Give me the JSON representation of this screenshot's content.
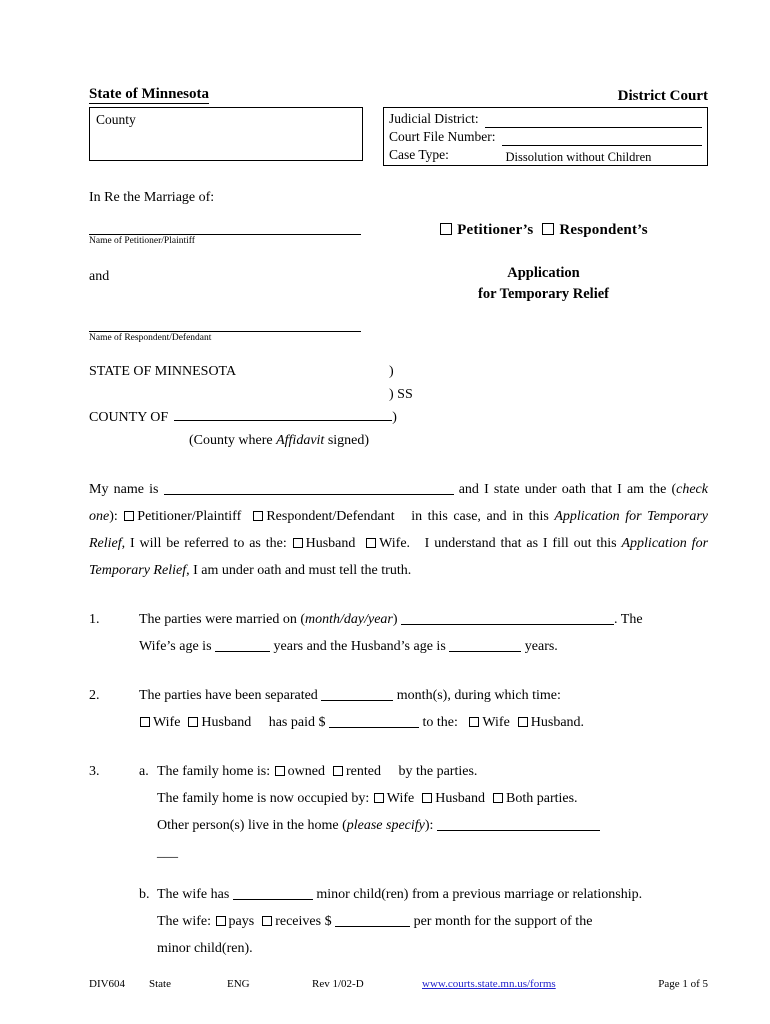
{
  "header": {
    "state_title": "State of Minnesota",
    "court_title": "District Court",
    "county_label": "County",
    "judicial_district_label": "Judicial District:",
    "judicial_district_value": "",
    "court_file_number_label": "Court File Number:",
    "court_file_number_value": "",
    "case_type_label": "Case Type:",
    "case_type_value": "Dissolution without Children"
  },
  "caption": {
    "in_re": "In Re the Marriage of:",
    "petitioner_caption": "Name of Petitioner/Plaintiff",
    "and": "and",
    "respondent_caption": "Name of Respondent/Defendant",
    "petitioners_label": "Petitioner’s",
    "respondents_label": "Respondent’s",
    "doc_title_line1": "Application",
    "doc_title_line2": "for Temporary Relief"
  },
  "venue": {
    "state_line": "STATE OF MINNESOTA",
    "paren_open": ")",
    "ss": ") SS",
    "county_of": "COUNTY OF",
    "paren_close": ")",
    "county_note_pre": "(County where ",
    "county_note_italic": "Affidavit",
    "county_note_post": " signed)"
  },
  "oath": {
    "p1_a": "My name is ",
    "p1_b": " and I state under oath that I am the (",
    "p1_check_one": "check  one",
    "p1_c": "): ",
    "p1_petitioner": "Petitioner/Plaintiff",
    "p1_respondent": "Respondent/Defendant",
    "p1_d": "in this case, and in this ",
    "p1_app_italic": "Application  for  Temporary  Relief",
    "p1_e": ", I will  be  referred  to  as  the: ",
    "p1_husband": "Husband",
    "p1_wife": "Wife.",
    "p1_f": "I understand that as I fill out this ",
    "p1_app_italic2": "Application for Temporary Relief",
    "p1_g": ", I am under oath and must tell the truth."
  },
  "items": [
    {
      "num": "1.",
      "line1_a": "The parties were married on (",
      "line1_italic": "month/day/year",
      "line1_b": ") ",
      "line1_c": ".    The",
      "line2_a": "Wife’s age is ",
      "line2_b": " years and the Husband’s age is ",
      "line2_c": " years."
    },
    {
      "num": "2.",
      "line1_a": "The parties have been separated ",
      "line1_b": " month(s), during which time:",
      "line2_wife": "Wife",
      "line2_husband": "Husband",
      "line2_a": "has paid $ ",
      "line2_b": " to the:   ",
      "line2_wife2": "Wife",
      "line2_husband2": "Husband."
    },
    {
      "num": "3.",
      "a_letter": "a.",
      "a_line1_a": "The family home is: ",
      "a_owned": "owned",
      "a_rented": "rented",
      "a_line1_b": "by the parties.",
      "a_line2_a": "The family home is now occupied by:    ",
      "a_wife": "Wife",
      "a_husband": "Husband",
      "a_both": "Both parties.",
      "a_line3_a": "Other person(s) live in the home (",
      "a_line3_italic": "please specify",
      "a_line3_b": "): ",
      "a_line4": "___",
      "b_letter": "b.",
      "b_line1_a": "The wife has ",
      "b_line1_b": " minor child(ren) from a previous marriage or relationship.",
      "b_line2_a": "The wife: ",
      "b_pays": "pays",
      "b_receives": "receives",
      "b_line2_b": "  $ ",
      "b_line2_c": " per  month  for  the  support  of  the",
      "b_line3": "minor child(ren)."
    }
  ],
  "footer": {
    "form_number": "DIV604",
    "scope": "State",
    "language": "ENG",
    "revision": "Rev 1/02-D",
    "url": "www.courts.state.mn.us/forms",
    "page": "Page 1 of 5"
  }
}
